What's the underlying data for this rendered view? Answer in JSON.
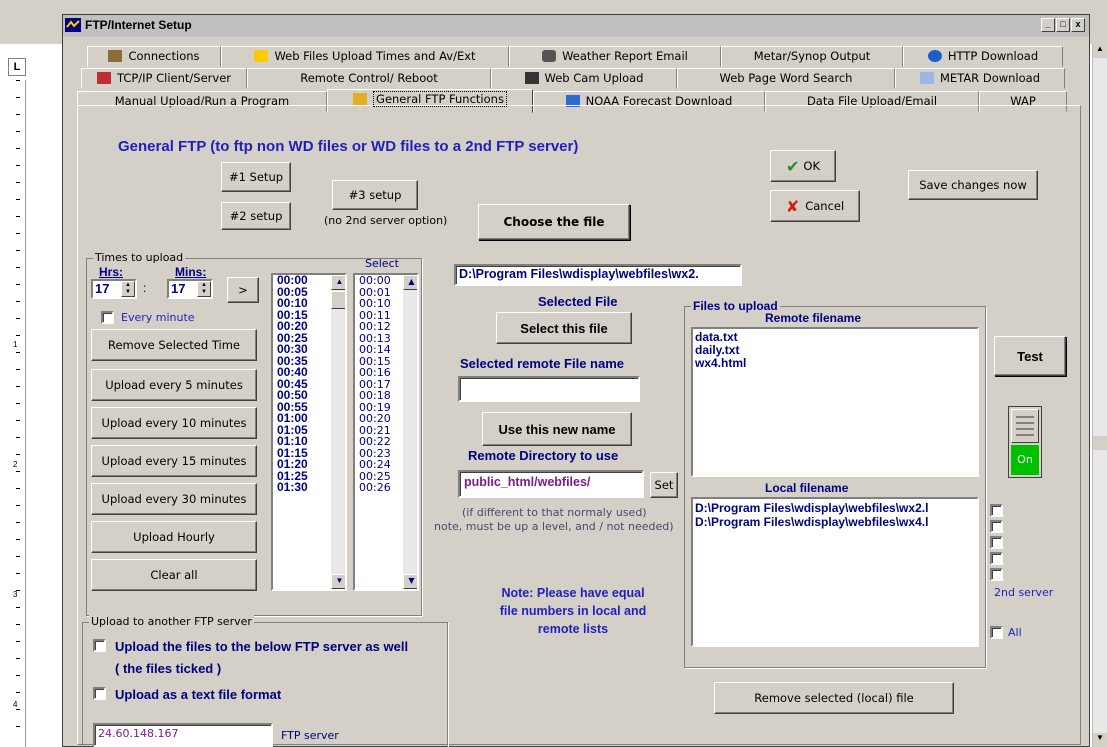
{
  "window": {
    "title": "FTP/Internet Setup",
    "min": "_",
    "max": "□",
    "close": "x"
  },
  "tabs": {
    "row1": [
      "Connections",
      "Web Files Upload Times and Av/Ext",
      "Weather Report Email",
      "Metar/Synop Output",
      "HTTP Download"
    ],
    "row2": [
      "TCP/IP Client/Server",
      "Remote Control/ Reboot",
      "Web Cam Upload",
      "Web Page Word Search",
      "METAR Download"
    ],
    "row3": [
      "Manual Upload/Run a Program",
      "General FTP Functions",
      "NOAA Forecast Download",
      "Data File Upload/Email",
      "WAP"
    ]
  },
  "heading": "General FTP (to ftp non WD files or WD files to a 2nd FTP server)",
  "setup": {
    "s1": "#1 Setup",
    "s2": "#2 setup",
    "s3": "#3 setup",
    "s3_note": "(no 2nd server option)"
  },
  "ok": "OK",
  "cancel": "Cancel",
  "save_changes": "Save changes now",
  "choose_file": "Choose the file",
  "times": {
    "group": "Times to upload",
    "hrs": "Hrs:",
    "mins": "Mins:",
    "hrs_value": "17",
    "mins_value": "17",
    "add": ">",
    "select": "Select",
    "every_minute": "Every minute",
    "remove": "Remove Selected Time",
    "buttons": [
      "Upload every 5 minutes",
      "Upload every 10 minutes",
      "Upload every 15 minutes",
      "Upload every 30 minutes",
      "Upload Hourly",
      "Clear all"
    ],
    "list": [
      "00:00",
      "00:05",
      "00:10",
      "00:15",
      "00:20",
      "00:25",
      "00:30",
      "00:35",
      "00:40",
      "00:45",
      "00:50",
      "00:55",
      "01:00",
      "01:05",
      "01:10",
      "01:15",
      "01:20",
      "01:25",
      "01:30"
    ],
    "select_list": [
      "00:00",
      "00:01",
      "00:10",
      "00:11",
      "00:12",
      "00:13",
      "00:14",
      "00:15",
      "00:16",
      "00:17",
      "00:18",
      "00:19",
      "00:20",
      "00:21",
      "00:22",
      "00:23",
      "00:24",
      "00:25",
      "00:26"
    ]
  },
  "selected_path": "D:\\Program Files\\wdisplay\\webfiles\\wx2.",
  "selected_file_label": "Selected File",
  "select_this_file": "Select this file",
  "remote_name_label": "Selected remote File name",
  "remote_name_value": "",
  "use_new_name": "Use this new name",
  "remote_dir_label": "Remote Directory to use",
  "remote_dir_value": "public_html/webfiles/",
  "set": "Set",
  "dir_note1": "(if different to that normaly used)",
  "dir_note2": "note, must be up a level, and / not needed)",
  "note": [
    "Note: Please have equal",
    "file numbers in local and",
    "remote lists"
  ],
  "files": {
    "group": "Files to upload",
    "remote_header": "Remote filename",
    "remote": [
      "data.txt",
      "daily.txt",
      "wx4.html"
    ],
    "local_header": "Local filename",
    "local": [
      "D:\\Program Files\\wdisplay\\webfiles\\wx2.l",
      "D:\\Program Files\\wdisplay\\webfiles\\wx4.l"
    ],
    "second_server": "2nd server",
    "all": "All"
  },
  "test": "Test",
  "switch_label": "On",
  "remove_local": "Remove selected (local) file",
  "another": {
    "group": "Upload to another FTP server",
    "opt1": "Upload the files to the below FTP server as well",
    "opt1b": "( the files ticked )",
    "opt2": "Upload as a text file format",
    "ip": "24.60.148.167",
    "ip_label": "FTP server"
  },
  "ruler_numbers": [
    "1",
    "2",
    "3",
    "4"
  ]
}
